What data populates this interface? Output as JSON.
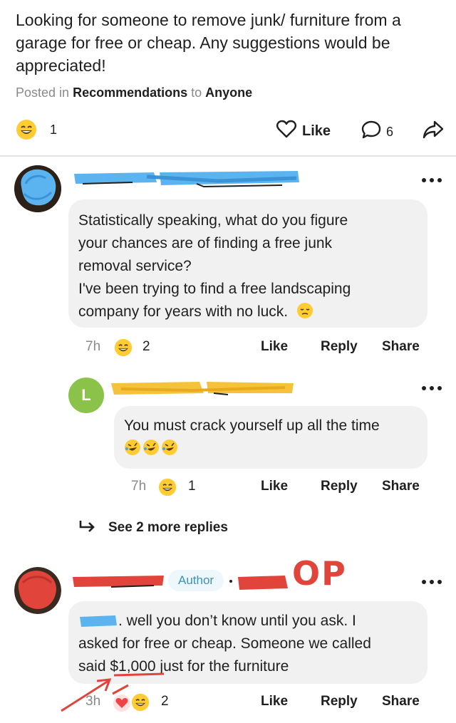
{
  "post": {
    "text": "Looking for someone to remove junk/ furniture from a garage for free or cheap. Any suggestions would be appreciated!",
    "posted_prefix": "Posted in",
    "category": "Recommendations",
    "to_word": "to",
    "audience": "Anyone",
    "reaction_count": "1",
    "like_label": "Like",
    "comment_count": "6"
  },
  "comments": [
    {
      "text_lines": [
        "Statistically speaking, what do you figure",
        "your chances are of finding a free junk",
        "removal service?",
        "I've been trying to find a free landscaping",
        "company for years with no luck."
      ],
      "time": "7h",
      "reaction_count": "2",
      "like": "Like",
      "reply": "Reply",
      "share": "Share"
    },
    {
      "avatar_letter": "L",
      "text": "You must crack yourself up all the time",
      "time": "7h",
      "reaction_count": "1",
      "like": "Like",
      "reply": "Reply",
      "share": "Share"
    },
    {
      "author_badge": "Author",
      "text_lines": [
        ". well you don’t know until you ask. I",
        "asked for free or cheap. Someone we called",
        "said $1,000 just for the furniture"
      ],
      "time": "3h",
      "reaction_count": "2",
      "like": "Like",
      "reply": "Reply",
      "share": "Share"
    }
  ],
  "see_more_replies": "See 2 more replies",
  "annotation": {
    "op_label": "OP"
  },
  "colors": {
    "redact_blue": "#5bb4ef",
    "redact_yellow": "#f5c33b",
    "redact_red": "#e0443a",
    "avatar_green": "#8bc34a",
    "author_badge": "#3b93b8"
  }
}
